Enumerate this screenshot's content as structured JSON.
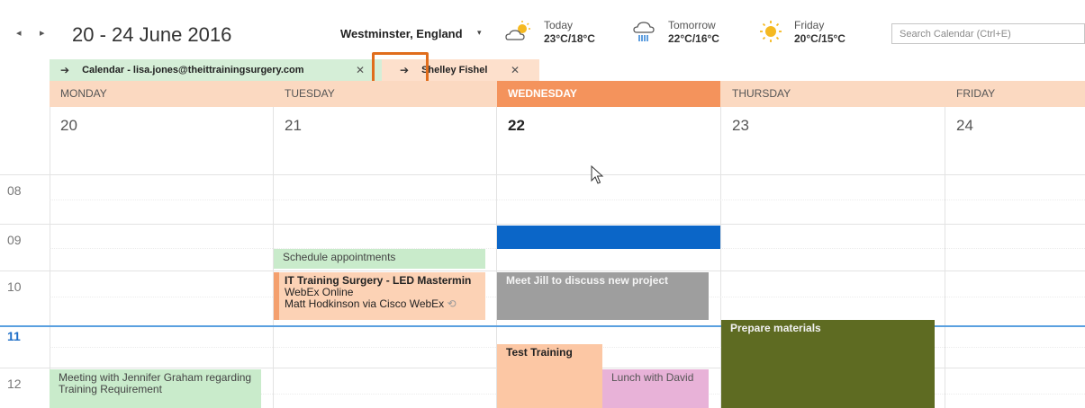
{
  "header": {
    "nav_prev_icon": "◂",
    "nav_next_icon": "▸",
    "date_range": "20 - 24 June 2016",
    "location": "Westminster, England",
    "location_caret": "▾",
    "weather": [
      {
        "label": "Today",
        "temp": "23°C/18°C",
        "icon": "partly-cloudy-icon"
      },
      {
        "label": "Tomorrow",
        "temp": "22°C/16°C",
        "icon": "rain-icon"
      },
      {
        "label": "Friday",
        "temp": "20°C/15°C",
        "icon": "sunny-icon"
      }
    ],
    "search_placeholder": "Search Calendar (Ctrl+E)"
  },
  "calendar_tabs": [
    {
      "arrow": "➔",
      "label": "Calendar - lisa.jones@theittrainingsurgery.com",
      "close": "✕"
    },
    {
      "arrow": "➔",
      "label": "Shelley Fishel",
      "close": "✕"
    }
  ],
  "days": [
    {
      "name": "MONDAY",
      "number": "20"
    },
    {
      "name": "TUESDAY",
      "number": "21"
    },
    {
      "name": "WEDNESDAY",
      "number": "22",
      "today": true
    },
    {
      "name": "THURSDAY",
      "number": "23"
    },
    {
      "name": "FRIDAY",
      "number": "24"
    }
  ],
  "hours": [
    "08",
    "09",
    "10",
    "11",
    "12"
  ],
  "events": {
    "schedule": "Schedule appointments",
    "it_title": "IT Training Surgery - LED Mastermin",
    "it_location": "WebEx Online",
    "it_organizer": "Matt Hodkinson via Cisco WebEx",
    "jill": "Meet Jill to discuss new project",
    "prepare": "Prepare materials",
    "test": "Test Training",
    "lunch": "Lunch with David",
    "meeting": "Meeting with Jennifer Graham regarding Training Requirement"
  },
  "colors": {
    "today_header": "#f4935c",
    "day_header": "#fbd9c1",
    "accent_orange": "#e06d1c",
    "now_line": "#5aa0e0"
  }
}
